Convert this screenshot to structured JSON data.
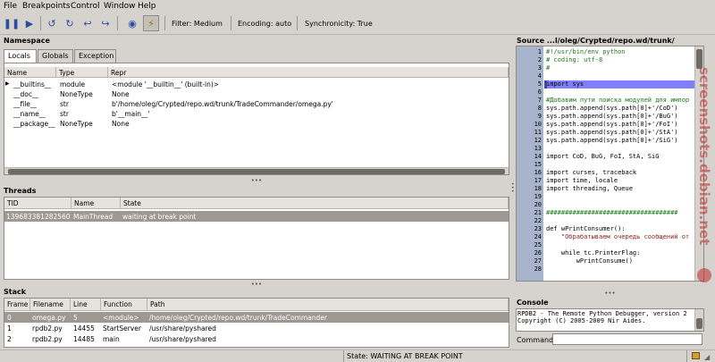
{
  "menu": [
    "File",
    "Breakpoints",
    "Control",
    "Window",
    "Help"
  ],
  "toolbar": {
    "filter": "Filter: Medium",
    "encoding": "Encoding: auto",
    "sync": "Synchronicity: True"
  },
  "namespace": {
    "title": "Namespace",
    "tabs": [
      "Locals",
      "Globals",
      "Exception"
    ],
    "columns": [
      "Name",
      "Type",
      "Repr"
    ],
    "rows": [
      {
        "expand": "▶",
        "name": "__builtins__",
        "type": "module",
        "repr": "<module '__builtin__' (built-in)>"
      },
      {
        "expand": "",
        "name": "__doc__",
        "type": "NoneType",
        "repr": "None"
      },
      {
        "expand": "",
        "name": "__file__",
        "type": "str",
        "repr": "b'/home/oleg/Crypted/repo.wd/trunk/TradeCommander/omega.py'"
      },
      {
        "expand": "",
        "name": "__name__",
        "type": "str",
        "repr": "b'__main__'"
      },
      {
        "expand": "",
        "name": "__package__",
        "type": "NoneType",
        "repr": "None"
      }
    ]
  },
  "threads": {
    "title": "Threads",
    "columns": [
      "TID",
      "Name",
      "State"
    ],
    "rows": [
      {
        "tid": "139683381282560",
        "name": "MainThread",
        "state": "waiting at break point"
      }
    ]
  },
  "stack": {
    "title": "Stack",
    "columns": [
      "Frame",
      "Filename",
      "Line",
      "Function",
      "Path"
    ],
    "rows": [
      {
        "frame": "0",
        "filename": "omega.py",
        "line": "5",
        "function": "<module>",
        "path": "/home/oleg/Crypted/repo.wd/trunk/TradeCommander"
      },
      {
        "frame": "1",
        "filename": "rpdb2.py",
        "line": "14455",
        "function": "StartServer",
        "path": "/usr/share/pyshared"
      },
      {
        "frame": "2",
        "filename": "rpdb2.py",
        "line": "14485",
        "function": "main",
        "path": "/usr/share/pyshared"
      }
    ]
  },
  "source": {
    "title": "Source ...l/oleg/Crypted/repo.wd/trunk/",
    "lines": [
      {
        "n": "1",
        "text": "#!/usr/bin/env python",
        "color": "#1a7a1a"
      },
      {
        "n": "2",
        "text": "# coding: utf-8",
        "color": "#1a7a1a"
      },
      {
        "n": "3",
        "text": "#",
        "color": "#1a7a1a"
      },
      {
        "n": "4",
        "text": "",
        "color": "#000000"
      },
      {
        "n": "5",
        "text": "import sys",
        "color": "#000000"
      },
      {
        "n": "6",
        "text": "",
        "color": "#000000"
      },
      {
        "n": "7",
        "text": "#Добавим пути поиска модулей для импор",
        "color": "#1a7a1a"
      },
      {
        "n": "8",
        "text": "sys.path.append(sys.path[0]+'/CoD')",
        "color": "#000000"
      },
      {
        "n": "9",
        "text": "sys.path.append(sys.path[0]+'/BuG')",
        "color": "#000000"
      },
      {
        "n": "10",
        "text": "sys.path.append(sys.path[0]+'/FoI')",
        "color": "#000000"
      },
      {
        "n": "11",
        "text": "sys.path.append(sys.path[0]+'/StA')",
        "color": "#000000"
      },
      {
        "n": "12",
        "text": "sys.path.append(sys.path[0]+'/SiG')",
        "color": "#000000"
      },
      {
        "n": "13",
        "text": "",
        "color": "#000000"
      },
      {
        "n": "14",
        "text": "import CoD, BuG, FoI, StA, SiG",
        "color": "#000000"
      },
      {
        "n": "15",
        "text": "",
        "color": "#000000"
      },
      {
        "n": "16",
        "text": "import curses, traceback",
        "color": "#000000"
      },
      {
        "n": "17",
        "text": "import time, locale",
        "color": "#000000"
      },
      {
        "n": "18",
        "text": "import threading, Queue",
        "color": "#000000"
      },
      {
        "n": "19",
        "text": "",
        "color": "#000000"
      },
      {
        "n": "20",
        "text": "",
        "color": "#000000"
      },
      {
        "n": "21",
        "text": "###################################",
        "color": "#1a7a1a"
      },
      {
        "n": "22",
        "text": "",
        "color": "#000000"
      },
      {
        "n": "23",
        "text": "def wPrintConsumer():",
        "color": "#000000"
      },
      {
        "n": "24",
        "text": "    \"Обрабатываем очередь сообщений от",
        "color": "#8a1a1a"
      },
      {
        "n": "25",
        "text": "",
        "color": "#000000"
      },
      {
        "n": "26",
        "text": "    while tc.PrinterFlag:",
        "color": "#000000"
      },
      {
        "n": "27",
        "text": "        wPrintConsume()",
        "color": "#000000"
      },
      {
        "n": "28",
        "text": "",
        "color": "#000000"
      }
    ]
  },
  "console": {
    "title": "Console",
    "lines": [
      "RPDB2 - The Remote Python Debugger, version 2",
      "Copyright (C) 2005-2009 Nir Aides."
    ],
    "command_label": "Command:",
    "command_value": ""
  },
  "status": {
    "state": "State: WAITING AT BREAK POINT"
  },
  "watermark": "screenshots.debian.net"
}
